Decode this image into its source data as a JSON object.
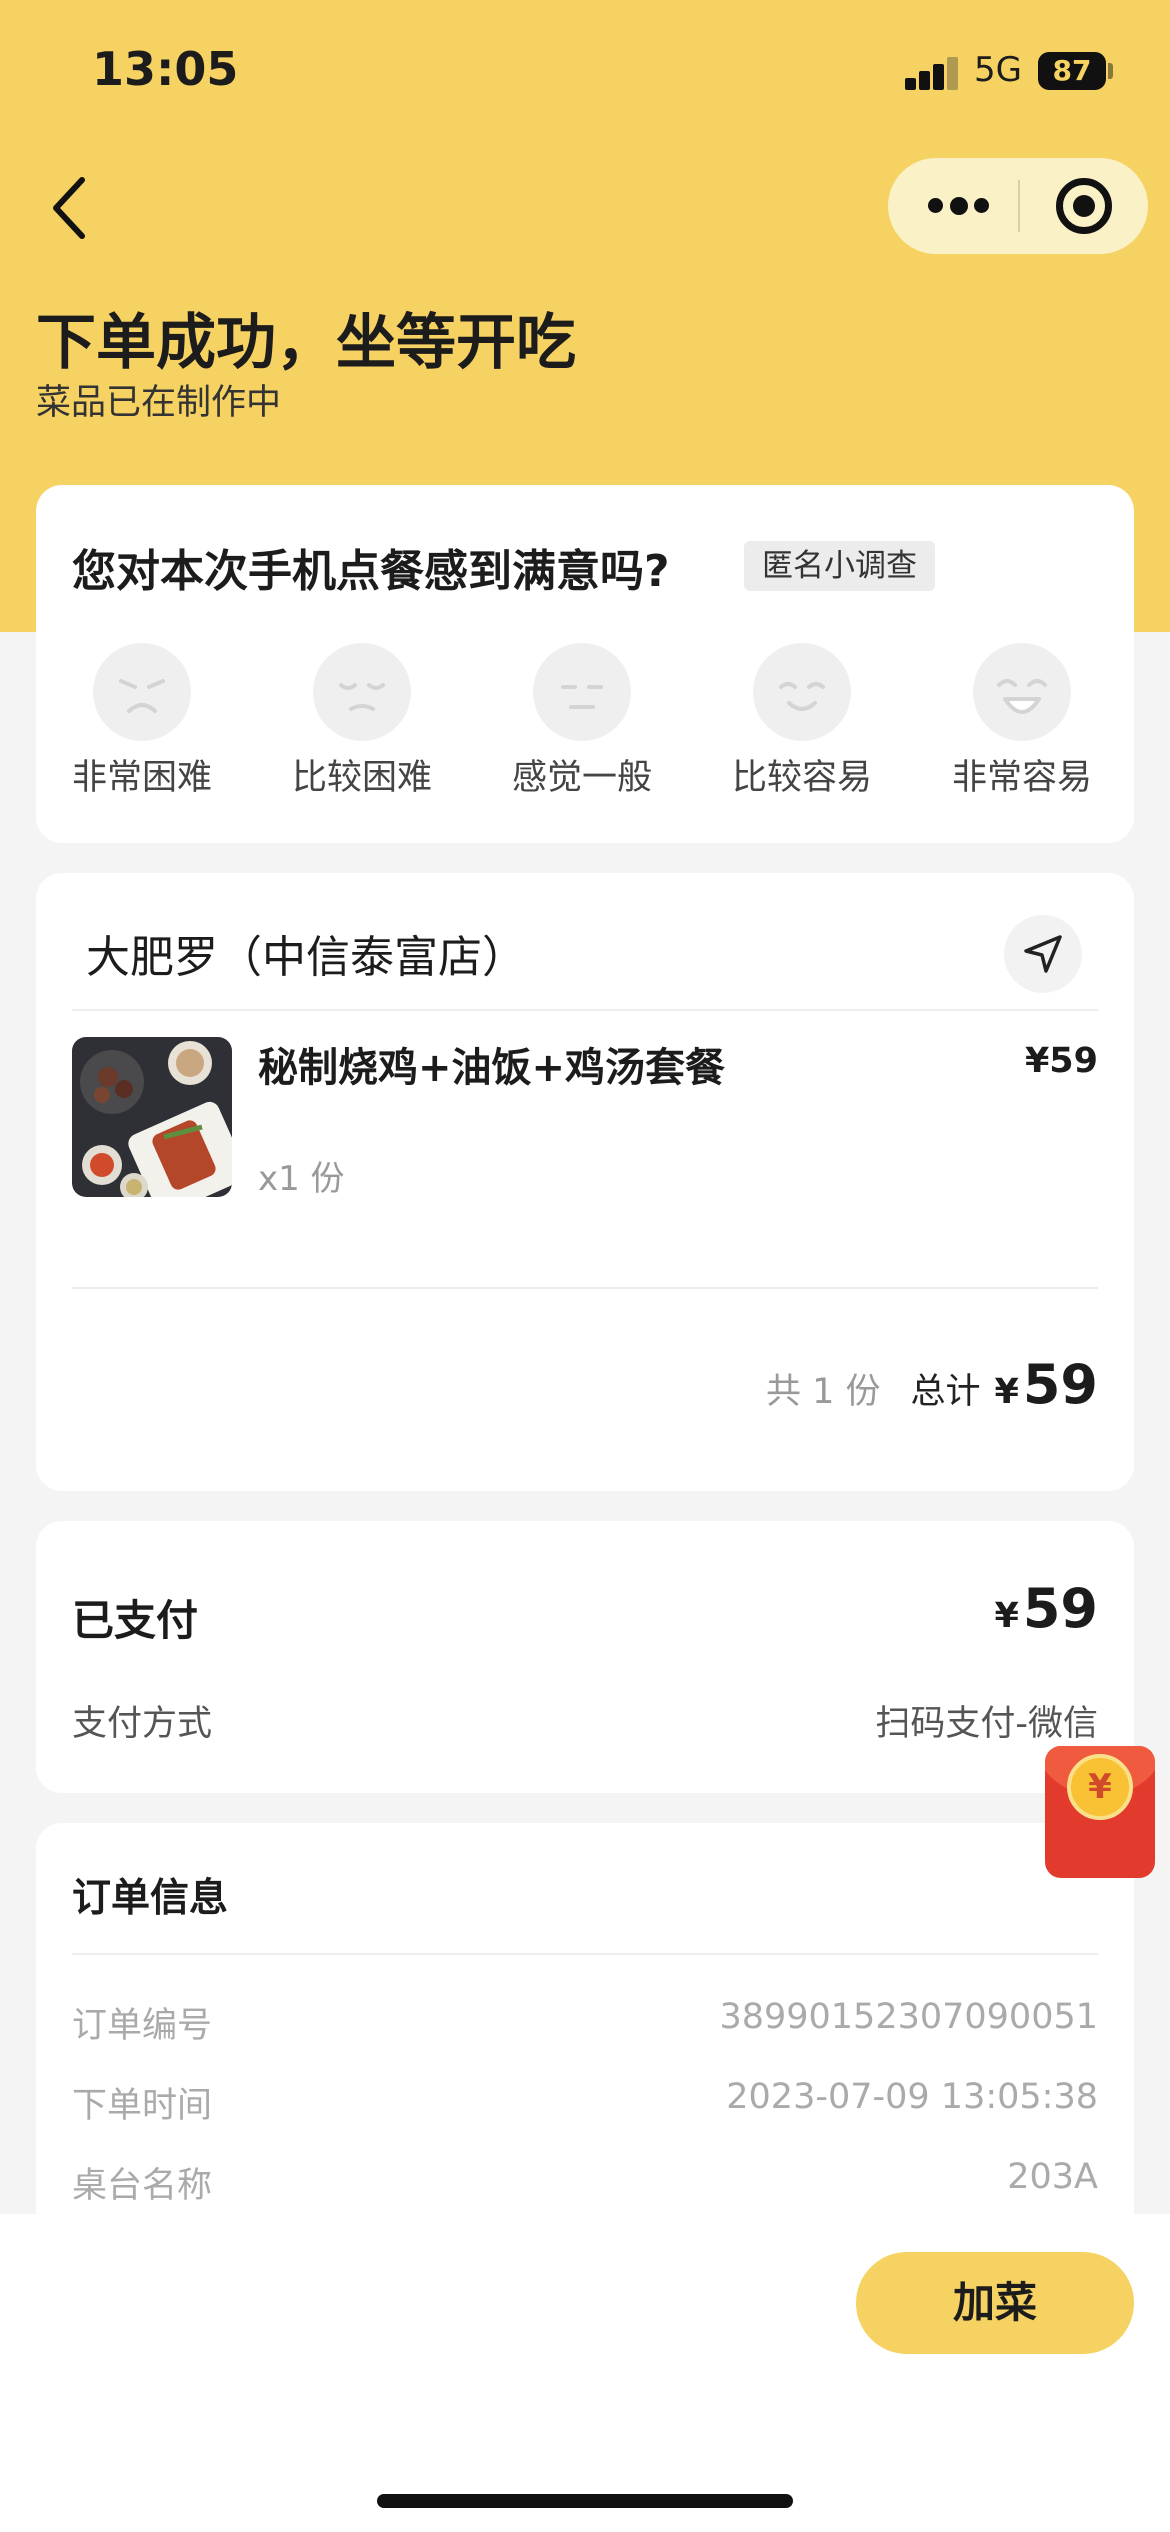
{
  "status_bar": {
    "time": "13:05",
    "network": "5G",
    "battery": "87"
  },
  "header": {
    "title": "下单成功，坐等开吃",
    "subtitle": "菜品已在制作中"
  },
  "survey": {
    "question": "您对本次手机点餐感到满意吗?",
    "tag": "匿名小调查",
    "options": [
      {
        "label": "非常困难",
        "icon": "angry-face-icon"
      },
      {
        "label": "比较困难",
        "icon": "sad-face-icon"
      },
      {
        "label": "感觉一般",
        "icon": "neutral-face-icon"
      },
      {
        "label": "比较容易",
        "icon": "smile-face-icon"
      },
      {
        "label": "非常容易",
        "icon": "laugh-face-icon"
      }
    ]
  },
  "order": {
    "store_name": "大肥罗（中信泰富店）",
    "item": {
      "name": "秘制烧鸡+油饭+鸡汤套餐",
      "price": "¥59",
      "quantity": "x1 份"
    },
    "count_text": "共 1 份",
    "total_label": "总计",
    "total_currency": "¥",
    "total_amount": "59"
  },
  "payment": {
    "status": "已支付",
    "currency": "¥",
    "amount": "59",
    "method_label": "支付方式",
    "method_value": "扫码支付-微信"
  },
  "order_info": {
    "title": "订单信息",
    "rows": [
      {
        "label": "订单编号",
        "value": "38990152307090051"
      },
      {
        "label": "下单时间",
        "value": "2023-07-09 13:05:38"
      },
      {
        "label": "桌台名称",
        "value": "203A"
      }
    ]
  },
  "red_packet": {
    "symbol": "¥"
  },
  "bottom": {
    "add_button": "加菜"
  },
  "colors": {
    "primary": "#f6d262",
    "background": "#f4f4f4",
    "card": "#ffffff",
    "red_packet": "#e23b2e"
  }
}
